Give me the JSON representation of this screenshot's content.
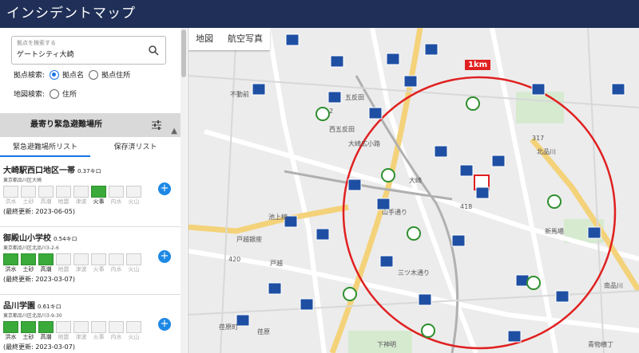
{
  "app": {
    "title": "インシデントマップ"
  },
  "search": {
    "placeholder": "拠点を検索する",
    "value": "ゲートシティ大崎"
  },
  "search_mode": {
    "label": "拠点検索:",
    "option1": "拠点名",
    "option2": "拠点住所"
  },
  "map_search": {
    "label": "地図検索:",
    "option1": "住所"
  },
  "section": {
    "title": "最寄り緊急避難場所"
  },
  "tabs": {
    "tab1": "緊急避難場所リスト",
    "tab2": "保存済リスト"
  },
  "hazard_labels": [
    "洪水",
    "土砂",
    "高潮",
    "地震",
    "津波",
    "火事",
    "内水",
    "火山"
  ],
  "items": [
    {
      "name": "大崎駅西口地区一帯",
      "distance": "0.37キロ",
      "address": "東京都品川区大崎",
      "active": [
        false,
        false,
        false,
        false,
        false,
        true,
        false,
        false
      ],
      "date": "(最終更新: 2023-06-05)"
    },
    {
      "name": "御殿山小学校",
      "distance": "0.54キロ",
      "address": "東京都品川区北品川3-2-6",
      "active": [
        true,
        true,
        true,
        false,
        false,
        false,
        false,
        false
      ],
      "date": "(最終更新: 2023-03-07)"
    },
    {
      "name": "品川学園",
      "distance": "0.61キロ",
      "address": "東京都品川区北品川3-9-30",
      "active": [
        true,
        true,
        true,
        false,
        false,
        false,
        false,
        false
      ],
      "date": "(最終更新: 2023-03-07)"
    }
  ],
  "map": {
    "tab_map": "地図",
    "tab_aerial": "航空写真",
    "scale": "1km",
    "labels": {
      "gotanda": "五反田",
      "nishigotanda": "西五反田",
      "osaki": "大崎",
      "kitashinagawa": "北品川",
      "shinbanba": "新馬場",
      "minamishinagawa": "南品川",
      "togoshiginza": "戸越銀座",
      "fudomae": "不動前",
      "ebara": "荏原",
      "osakihiroshoji": "大崎広小路",
      "mitsugidori": "三ツ木通り",
      "route418": "418",
      "route420": "420",
      "route317": "317",
      "route2": "2",
      "togoshi": "戸越",
      "ikeuesen": "池上線",
      "yamatedori": "山手通り",
      "ebaramachi": "荏原町",
      "shimoshinmei": "下神明",
      "aomonoyokocho": "青物横丁",
      "kitashinagawa_label": "北品川",
      "gotanda_bridge": "五反田"
    }
  },
  "colors": {
    "header": "#1f2f57",
    "accent": "#1a73e8",
    "circle": "#e02020",
    "hazard_on": "#3aaa3a"
  }
}
